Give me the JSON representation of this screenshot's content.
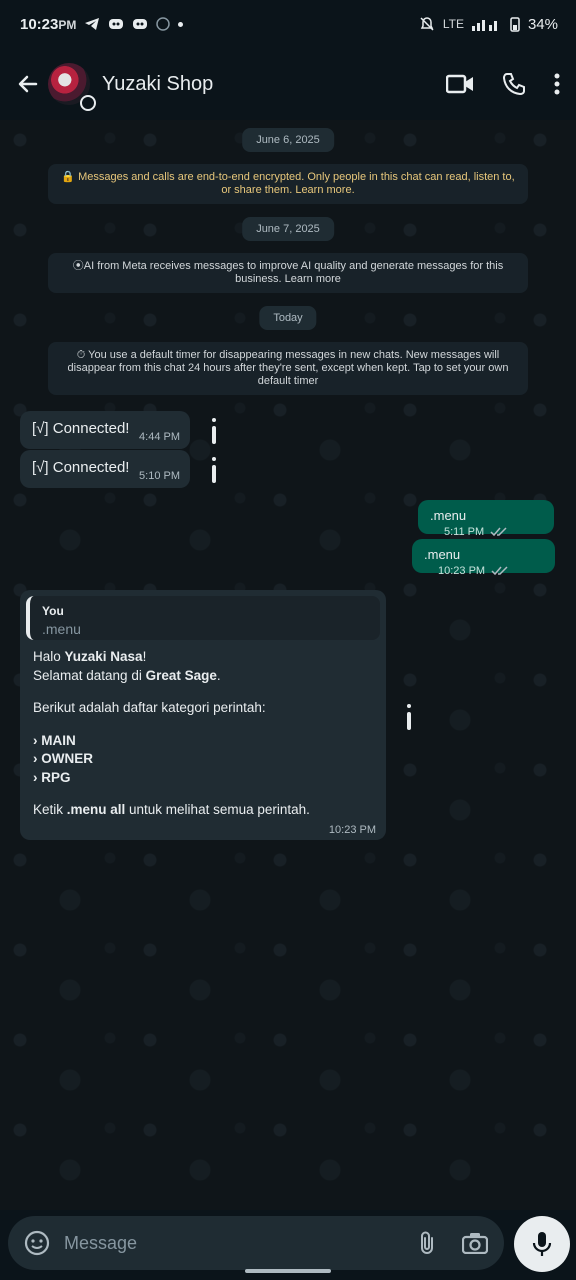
{
  "status_bar": {
    "time": "10:23",
    "am_pm": "PM",
    "network": "LTE",
    "battery": "34%"
  },
  "header": {
    "contact_name": "Yuzaki Shop"
  },
  "chat": {
    "dates": {
      "d1": "June 6, 2025",
      "d2": "June 7, 2025",
      "d3": "Today"
    },
    "system_messages": {
      "encryption": "🔒 Messages and calls are end-to-end encrypted. Only people in this chat can read, listen to, or share them. Learn more.",
      "meta_ai": "⦿AI from Meta receives messages to improve AI quality and generate messages for this business. Learn more",
      "timer": "⏱ You use a default timer for disappearing messages in new chats. New messages will disappear from this chat 24 hours after they're sent, except when kept. Tap to set your own default timer"
    },
    "incoming_1": {
      "text": "[√] Connected!",
      "time": "4:44 PM"
    },
    "incoming_2": {
      "text": "[√] Connected!",
      "time": "5:10 PM"
    },
    "outgoing_1": {
      "text": ".menu",
      "time": "5:11 PM"
    },
    "outgoing_2": {
      "text": ".menu",
      "time": "10:23 PM"
    },
    "menu_reply": {
      "quote_sender": "You",
      "quote_text": ".menu",
      "greeting_prefix": "Halo ",
      "user_name": "Yuzaki Nasa",
      "greeting_suffix": "!",
      "welcome_prefix": "Selamat datang di ",
      "bot_name": "Great Sage",
      "welcome_suffix": ".",
      "intro": "Berikut adalah daftar kategori perintah:",
      "categories": [
        "› MAIN",
        "› OWNER",
        "› RPG"
      ],
      "footer_prefix": "Ketik ",
      "footer_cmd": ".menu all",
      "footer_suffix": " untuk melihat semua perintah.",
      "time": "10:23 PM"
    }
  },
  "composer": {
    "placeholder": "Message"
  }
}
